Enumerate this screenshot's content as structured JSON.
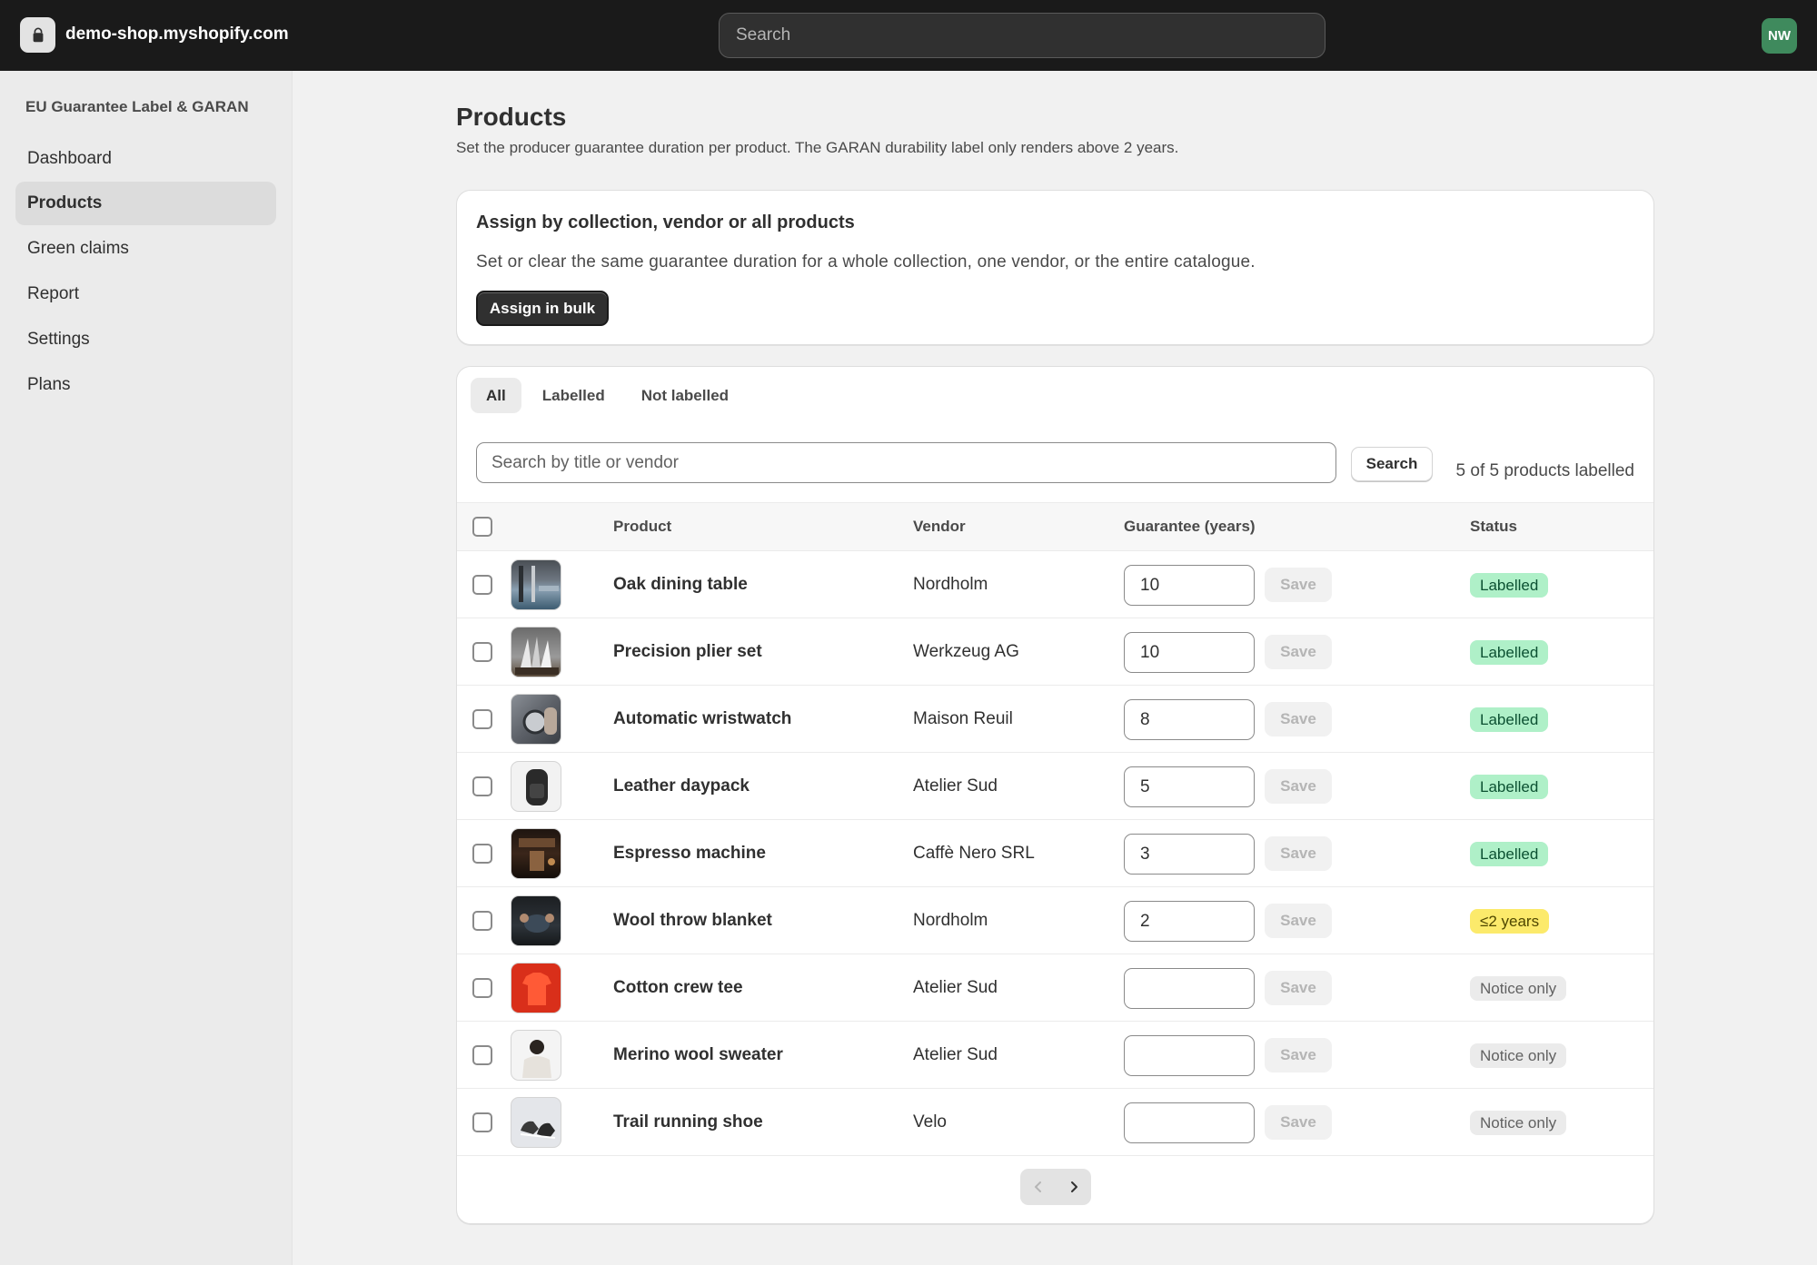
{
  "topbar": {
    "store_name": "demo-shop.myshopify.com",
    "store_icon": "shopping-bag-icon",
    "search_placeholder": "Search",
    "avatar_initials": "NW",
    "avatar_color": "#3f8a5d"
  },
  "sidebar": {
    "app_name": "EU Guarantee Label & GARAN",
    "items": [
      {
        "label": "Dashboard",
        "active": false
      },
      {
        "label": "Products",
        "active": true
      },
      {
        "label": "Green claims",
        "active": false
      },
      {
        "label": "Report",
        "active": false
      },
      {
        "label": "Settings",
        "active": false
      },
      {
        "label": "Plans",
        "active": false
      }
    ]
  },
  "page": {
    "title": "Products",
    "subtitle": "Set the producer guarantee duration per product. The GARAN durability label only renders above 2 years."
  },
  "bulk": {
    "title": "Assign by collection, vendor or all products",
    "text": "Set or clear the same guarantee duration for a whole collection, one vendor, or the entire catalogue.",
    "button": "Assign in bulk"
  },
  "table": {
    "tabs": [
      {
        "label": "All",
        "active": true
      },
      {
        "label": "Labelled",
        "active": false
      },
      {
        "label": "Not labelled",
        "active": false
      }
    ],
    "search_placeholder": "Search by title or vendor",
    "search_button": "Search",
    "count_text": "5 of 5 products labelled",
    "columns": {
      "product": "Product",
      "vendor": "Vendor",
      "guarantee": "Guarantee (years)",
      "status": "Status"
    },
    "save_label": "Save",
    "rows": [
      {
        "title": "Oak dining table",
        "vendor": "Nordholm",
        "years": "10",
        "status": "Labelled",
        "status_kind": "ok"
      },
      {
        "title": "Precision plier set",
        "vendor": "Werkzeug AG",
        "years": "10",
        "status": "Labelled",
        "status_kind": "ok"
      },
      {
        "title": "Automatic wristwatch",
        "vendor": "Maison Reuil",
        "years": "8",
        "status": "Labelled",
        "status_kind": "ok"
      },
      {
        "title": "Leather daypack",
        "vendor": "Atelier Sud",
        "years": "5",
        "status": "Labelled",
        "status_kind": "ok"
      },
      {
        "title": "Espresso machine",
        "vendor": "Caffè Nero SRL",
        "years": "3",
        "status": "Labelled",
        "status_kind": "ok"
      },
      {
        "title": "Wool throw blanket",
        "vendor": "Nordholm",
        "years": "2",
        "status": "≤2 years",
        "status_kind": "warn"
      },
      {
        "title": "Cotton crew tee",
        "vendor": "Atelier Sud",
        "years": "",
        "status": "Notice only",
        "status_kind": "neutral"
      },
      {
        "title": "Merino wool sweater",
        "vendor": "Atelier Sud",
        "years": "",
        "status": "Notice only",
        "status_kind": "neutral"
      },
      {
        "title": "Trail running shoe",
        "vendor": "Velo",
        "years": "",
        "status": "Notice only",
        "status_kind": "neutral"
      }
    ]
  },
  "pagination": {
    "prev_icon": "chevron-left-icon",
    "next_icon": "chevron-right-icon"
  }
}
